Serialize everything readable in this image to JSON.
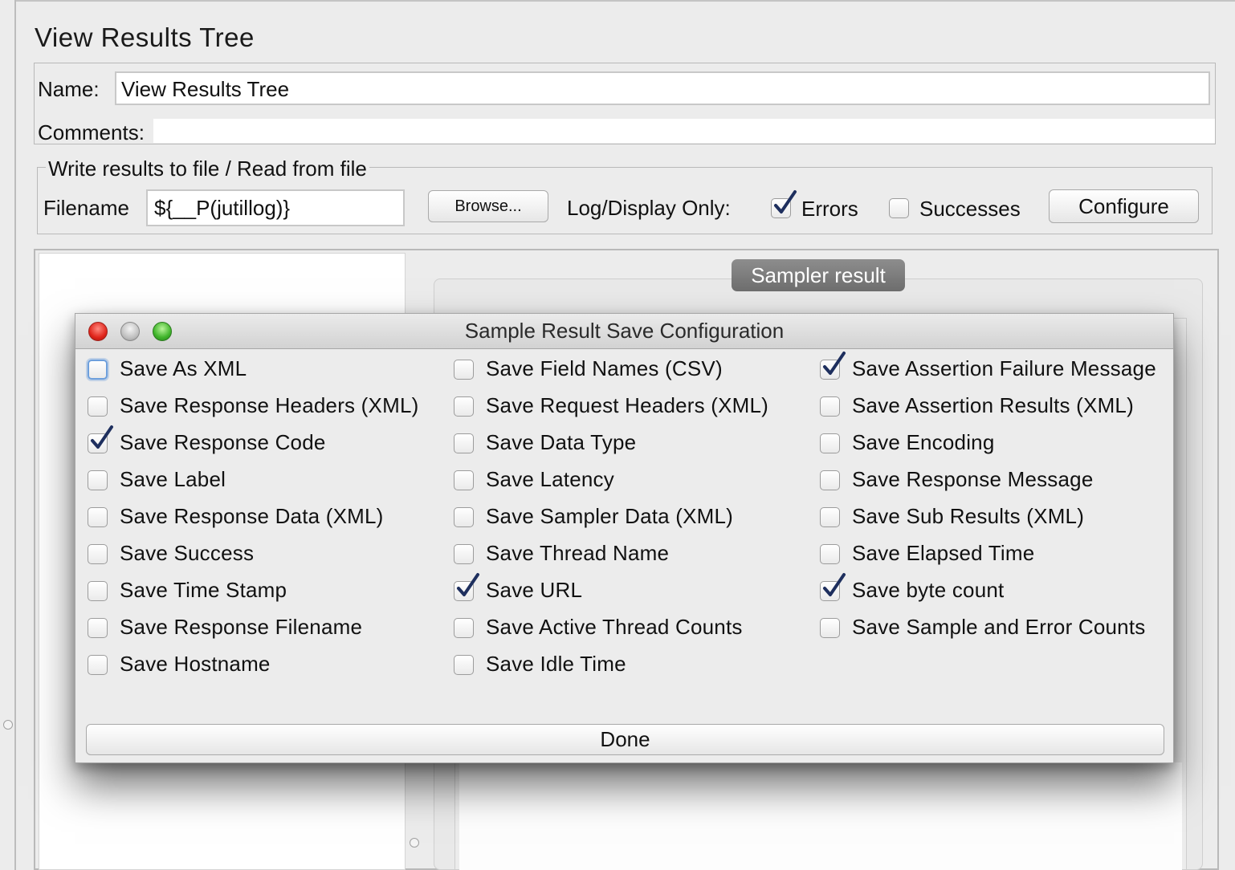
{
  "page": {
    "title": "View Results Tree",
    "name_label": "Name:",
    "name_value": "View Results Tree",
    "comments_label": "Comments:"
  },
  "file": {
    "legend": "Write results to file / Read from file",
    "filename_label": "Filename",
    "filename_value": "${__P(jutillog)}",
    "browse_label": "Browse...",
    "log_label": "Log/Display Only:",
    "errors_label": "Errors",
    "errors_checked": true,
    "successes_label": "Successes",
    "successes_checked": false,
    "configure_label": "Configure"
  },
  "results": {
    "tab_label": "Sampler result"
  },
  "dialog": {
    "title": "Sample Result Save Configuration",
    "done_label": "Done",
    "columns": [
      [
        {
          "label": "Save As XML",
          "checked": false,
          "focused": true
        },
        {
          "label": "Save Response Headers (XML)",
          "checked": false
        },
        {
          "label": "Save Response Code",
          "checked": true
        },
        {
          "label": "Save Label",
          "checked": false
        },
        {
          "label": "Save Response Data (XML)",
          "checked": false
        },
        {
          "label": "Save Success",
          "checked": false
        },
        {
          "label": "Save Time Stamp",
          "checked": false
        },
        {
          "label": "Save Response Filename",
          "checked": false
        },
        {
          "label": "Save Hostname",
          "checked": false
        }
      ],
      [
        {
          "label": "Save Field Names (CSV)",
          "checked": false
        },
        {
          "label": "Save Request Headers (XML)",
          "checked": false
        },
        {
          "label": "Save Data Type",
          "checked": false
        },
        {
          "label": "Save Latency",
          "checked": false
        },
        {
          "label": "Save Sampler Data (XML)",
          "checked": false
        },
        {
          "label": "Save Thread Name",
          "checked": false
        },
        {
          "label": "Save URL",
          "checked": true
        },
        {
          "label": "Save Active Thread Counts",
          "checked": false
        },
        {
          "label": "Save Idle Time",
          "checked": false
        }
      ],
      [
        {
          "label": "Save Assertion Failure Message",
          "checked": true
        },
        {
          "label": "Save Assertion Results (XML)",
          "checked": false
        },
        {
          "label": "Save Encoding",
          "checked": false
        },
        {
          "label": "Save Response Message",
          "checked": false
        },
        {
          "label": "Save Sub Results (XML)",
          "checked": false
        },
        {
          "label": "Save Elapsed Time",
          "checked": false
        },
        {
          "label": "Save byte count",
          "checked": true
        },
        {
          "label": "Save Sample and Error Counts",
          "checked": false
        }
      ]
    ]
  },
  "colors": {
    "tick": "#1e2f5e",
    "focus_ring": "#6d9fdc",
    "background": "#ececec"
  }
}
